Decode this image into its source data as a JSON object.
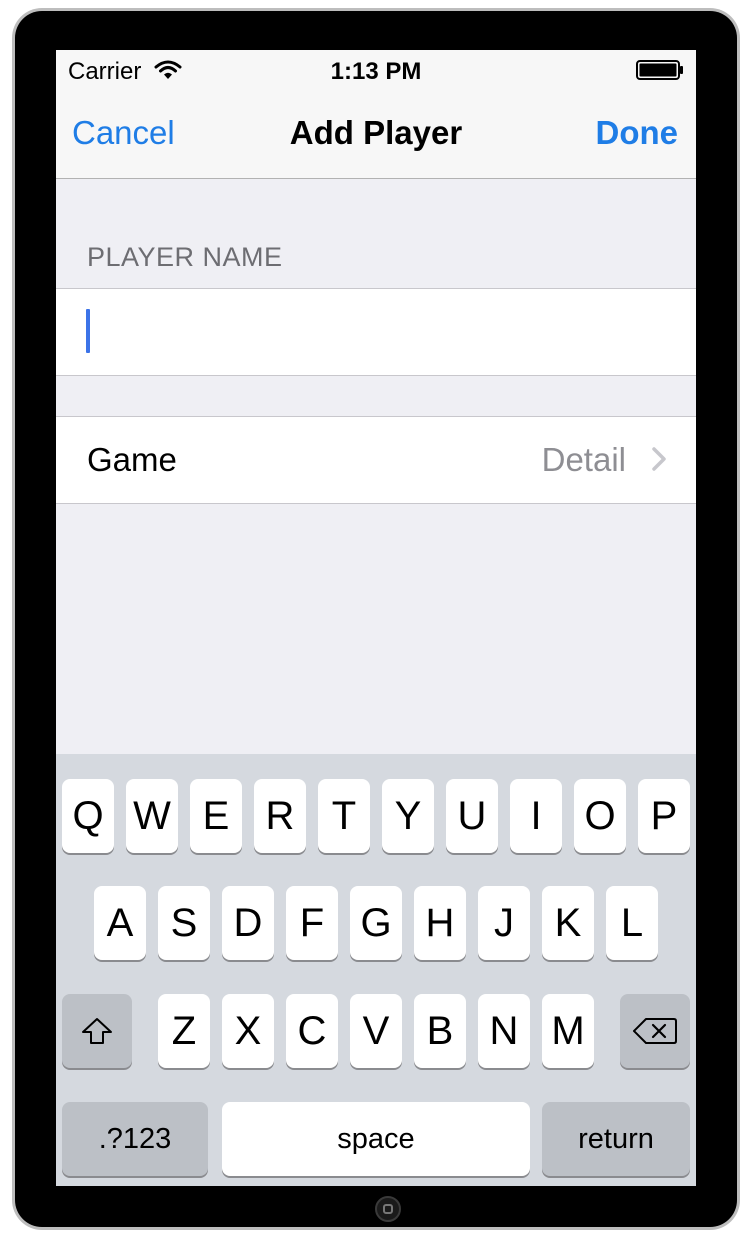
{
  "status_bar": {
    "carrier": "Carrier",
    "time": "1:13 PM"
  },
  "nav": {
    "cancel": "Cancel",
    "title": "Add Player",
    "done": "Done"
  },
  "form": {
    "section_header": "PLAYER NAME",
    "name_value": "",
    "game_label": "Game",
    "game_detail": "Detail"
  },
  "keyboard": {
    "row1": [
      "Q",
      "W",
      "E",
      "R",
      "T",
      "Y",
      "U",
      "I",
      "O",
      "P"
    ],
    "row2": [
      "A",
      "S",
      "D",
      "F",
      "G",
      "H",
      "J",
      "K",
      "L"
    ],
    "row3": [
      "Z",
      "X",
      "C",
      "V",
      "B",
      "N",
      "M"
    ],
    "numbers_label": ".?123",
    "space_label": "space",
    "return_label": "return"
  },
  "colors": {
    "accent": "#1f7de6",
    "caret": "#3c73e8",
    "detail": "#8e8e93"
  }
}
